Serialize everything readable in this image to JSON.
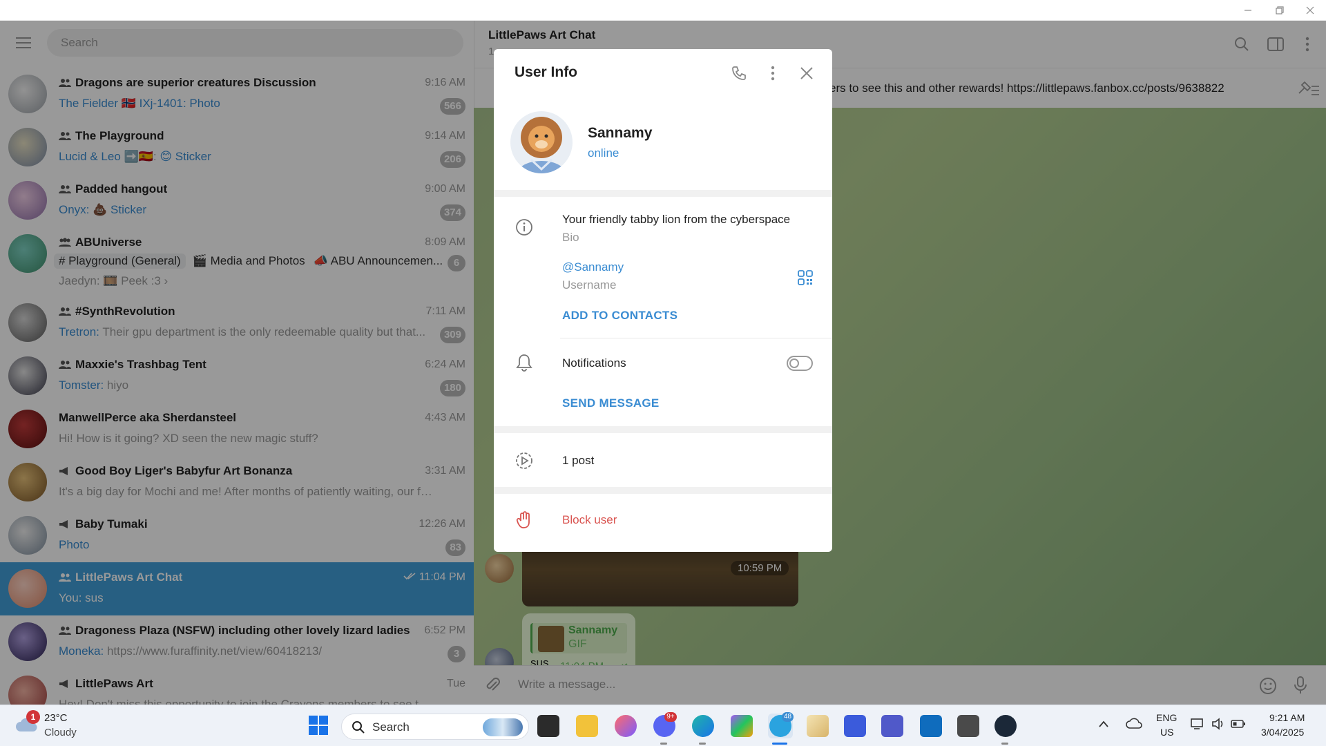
{
  "left_panel": {
    "search_placeholder": "Search",
    "chats": [
      {
        "title": "Dragons are superior creatures Discussion",
        "time": "9:16 AM",
        "sender": "The Fielder",
        "sender_flag": "🇳🇴",
        "sender2": "IXj-1401:",
        "media": "Photo",
        "badge": "566"
      },
      {
        "title": "The Playground",
        "time": "9:14 AM",
        "sender": "Lucid & Leo",
        "sender_extra": "➡️🇪🇸:",
        "media": "😊 Sticker",
        "badge": "206"
      },
      {
        "title": "Padded hangout",
        "time": "9:00 AM",
        "sender": "Onyx:",
        "media": "💩 Sticker",
        "badge": "374"
      },
      {
        "title": "ABUniverse",
        "time": "8:09 AM",
        "topic1": "# Playground (General)",
        "topic2": "🎬 Media and Photos",
        "topic3": "📣 ABU Announcemen...",
        "preview": "Jaedyn: 🎞️ Peek :3 ›",
        "badge": "6"
      },
      {
        "title": "#SynthRevolution",
        "time": "7:11 AM",
        "sender": "Tretron:",
        "preview": "Their gpu department is the only redeemable quality but that...",
        "badge": "309"
      },
      {
        "title": "Maxxie's Trashbag Tent",
        "time": "6:24 AM",
        "sender": "Tomster:",
        "preview": "hiyo",
        "badge": "180"
      },
      {
        "title": "ManwellPerce aka Sherdansteel",
        "time": "4:43 AM",
        "preview": "Hi! How is it going? XD seen the new magic stuff?"
      },
      {
        "title": "Good Boy Liger's Babyfur Art Bonanza",
        "time": "3:31 AM",
        "preview": "It's a big day for Mochi and me! After months of patiently waiting, our fur..."
      },
      {
        "title": "Baby Tumaki",
        "time": "12:26 AM",
        "media": "Photo",
        "badge": "83"
      },
      {
        "title": "LittlePaws Art Chat",
        "time": "11:04 PM",
        "preview": "You: sus"
      },
      {
        "title": "Dragoness Plaza (NSFW) including other lovely lizard ladies",
        "time": "6:52 PM",
        "sender": "Moneka:",
        "preview": "https://www.furaffinity.net/view/60418213/",
        "badge": "3"
      },
      {
        "title": "LittlePaws Art",
        "time": "Tue",
        "preview": "Hey! Don't miss this opportunity to join the Crayons members to see this..."
      }
    ]
  },
  "chat": {
    "title": "LittlePaws Art Chat",
    "subtitle": "1",
    "pinned": "ers to see this and other rewards!  https://littlepaws.fanbox.cc/posts/9638822",
    "photo_time": "10:59 PM",
    "gif_name": "Sannamy",
    "gif_type": "GIF",
    "gif_text": "sus",
    "gif_time": "11:04 PM",
    "composer_placeholder": "Write a message..."
  },
  "modal": {
    "title": "User Info",
    "name": "Sannamy",
    "status": "online",
    "bio": "Your friendly tabby lion from the cyberspace",
    "bio_label": "Bio",
    "username": "@Sannamy",
    "username_label": "Username",
    "add_contacts": "ADD TO CONTACTS",
    "notifications": "Notifications",
    "notifications_on": false,
    "send_message": "SEND MESSAGE",
    "posts": "1 post",
    "block": "Block user"
  },
  "taskbar": {
    "weather_temp": "23°C",
    "weather_cond": "Cloudy",
    "weather_badge": "1",
    "search": "Search",
    "lang": "ENG",
    "region": "US",
    "time": "9:21 AM",
    "date": "3/04/2025",
    "telegram_badge": "48"
  },
  "colors": {
    "accent": "#419fd9",
    "link": "#3a8cd2",
    "danger": "#d9534f"
  }
}
